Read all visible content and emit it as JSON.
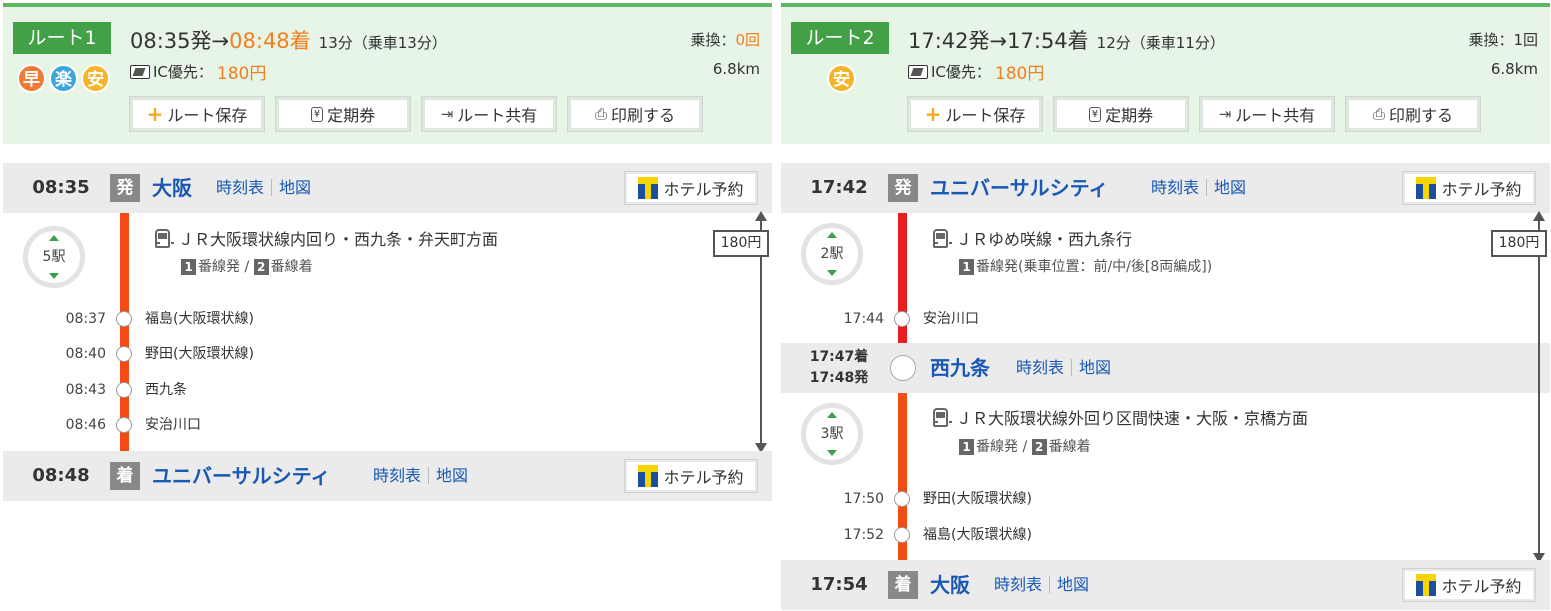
{
  "colors": {
    "accent_green": "#42a047",
    "header_bg": "#e7f5e6",
    "link_blue": "#1a58b5",
    "highlight_orange": "#f27e1e",
    "rail_orange": "#f24c14",
    "rail_red": "#e81d1d"
  },
  "common": {
    "buttons": {
      "save": "ルート保存",
      "pass": "定期券",
      "share": "ルート共有",
      "print": "印刷する"
    },
    "pass_icon_text": "¥",
    "ic_label": "IC優先：",
    "transfers_label": "乗換：",
    "timetable": "時刻表",
    "map": "地図",
    "hotel": "ホテル予約",
    "icons": {
      "save": "plus-icon",
      "pass": "ticket-icon",
      "share": "share-icon",
      "print": "printer-icon",
      "hotel": "t-point-logo",
      "line": "train-icon",
      "ic": "ic-card-icon"
    }
  },
  "route1": {
    "tag": "ルート1",
    "badges": [
      "早",
      "楽",
      "安"
    ],
    "depart": "08:35発",
    "arrow": "→",
    "arrive": "08:48着",
    "duration": "13分（乗車13分）",
    "fare": "180円",
    "transfers": "0回",
    "distance": "6.8km",
    "from": {
      "time": "08:35",
      "mark": "発",
      "name": "大阪"
    },
    "leg": {
      "stops_count": "5駅",
      "line": "ＪＲ大阪環状線内回り・西九条・弁天町方面",
      "dep_track": "1",
      "dep_suffix": "番線発 / ",
      "arr_track": "2",
      "arr_suffix": "番線着",
      "fare": "180円",
      "stops": [
        {
          "time": "08:37",
          "name": "福島(大阪環状線)"
        },
        {
          "time": "08:40",
          "name": "野田(大阪環状線)"
        },
        {
          "time": "08:43",
          "name": "西九条"
        },
        {
          "time": "08:46",
          "name": "安治川口"
        }
      ]
    },
    "to": {
      "time": "08:48",
      "mark": "着",
      "name": "ユニバーサルシティ"
    }
  },
  "route2": {
    "tag": "ルート2",
    "badges": [
      "安"
    ],
    "depart": "17:42発",
    "arrow": "→",
    "arrive": "17:54着",
    "duration": "12分（乗車11分）",
    "fare": "180円",
    "transfers": "1回",
    "distance": "6.8km",
    "from": {
      "time": "17:42",
      "mark": "発",
      "name": "ユニバーサルシティ"
    },
    "leg1": {
      "stops_count": "2駅",
      "line": "ＪＲゆめ咲線・西九条行",
      "dep_track": "1",
      "dep_suffix": "番線発(乗車位置：前/中/後[8両編成])",
      "fare": "180円",
      "stops": [
        {
          "time": "17:44",
          "name": "安治川口"
        }
      ]
    },
    "transfer": {
      "arr_time": "17:47着",
      "dep_time": "17:48発",
      "name": "西九条"
    },
    "leg2": {
      "stops_count": "3駅",
      "line": "ＪＲ大阪環状線外回り区間快速・大阪・京橋方面",
      "dep_track": "1",
      "dep_suffix": "番線発 / ",
      "arr_track": "2",
      "arr_suffix": "番線着",
      "stops": [
        {
          "time": "17:50",
          "name": "野田(大阪環状線)"
        },
        {
          "time": "17:52",
          "name": "福島(大阪環状線)"
        }
      ]
    },
    "to": {
      "time": "17:54",
      "mark": "着",
      "name": "大阪"
    }
  }
}
